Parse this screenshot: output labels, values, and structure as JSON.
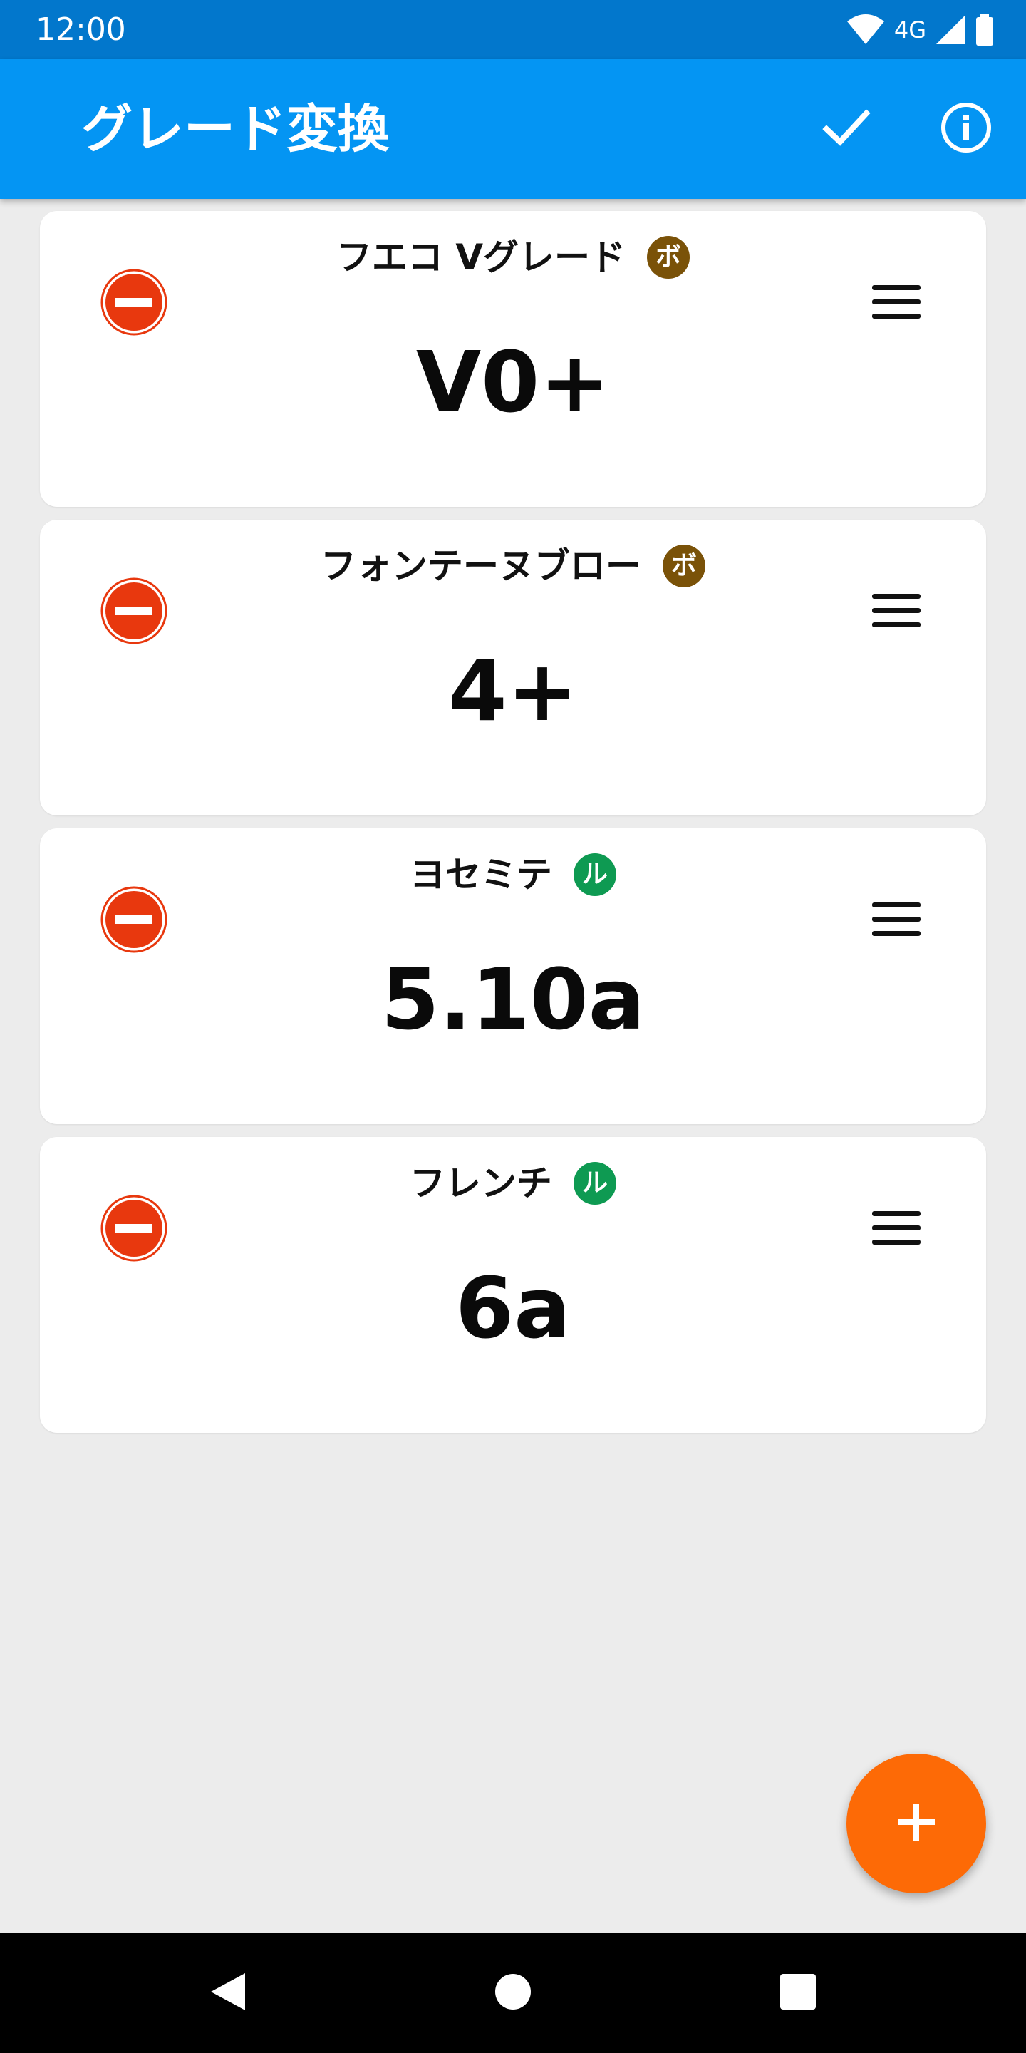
{
  "status_bar": {
    "time": "12:00",
    "network": "4G",
    "icons": [
      "wifi-icon",
      "cell-signal-icon",
      "battery-icon"
    ]
  },
  "app_bar": {
    "title": "グレード変換",
    "actions": [
      "check-icon",
      "info-icon"
    ],
    "color": "#0495f3"
  },
  "cards": [
    {
      "name": "フエコ Vグレード",
      "badge": "ボ",
      "badge_color": "#7a5208",
      "grade": "V0+"
    },
    {
      "name": "フォンテーヌブロー",
      "badge": "ボ",
      "badge_color": "#7a5208",
      "grade": "4+"
    },
    {
      "name": "ヨセミテ",
      "badge": "ル",
      "badge_color": "#0e9a52",
      "grade": "5.10a"
    },
    {
      "name": "フレンチ",
      "badge": "ル",
      "badge_color": "#0e9a52",
      "grade": "6a"
    }
  ],
  "colors": {
    "remove": "#e8380e",
    "fab": "#fd6a06",
    "status_bar": "#0277cc"
  },
  "fab": {
    "icon": "plus-icon"
  },
  "nav_bar": {
    "buttons": [
      "back-icon",
      "home-icon",
      "recents-icon"
    ]
  }
}
